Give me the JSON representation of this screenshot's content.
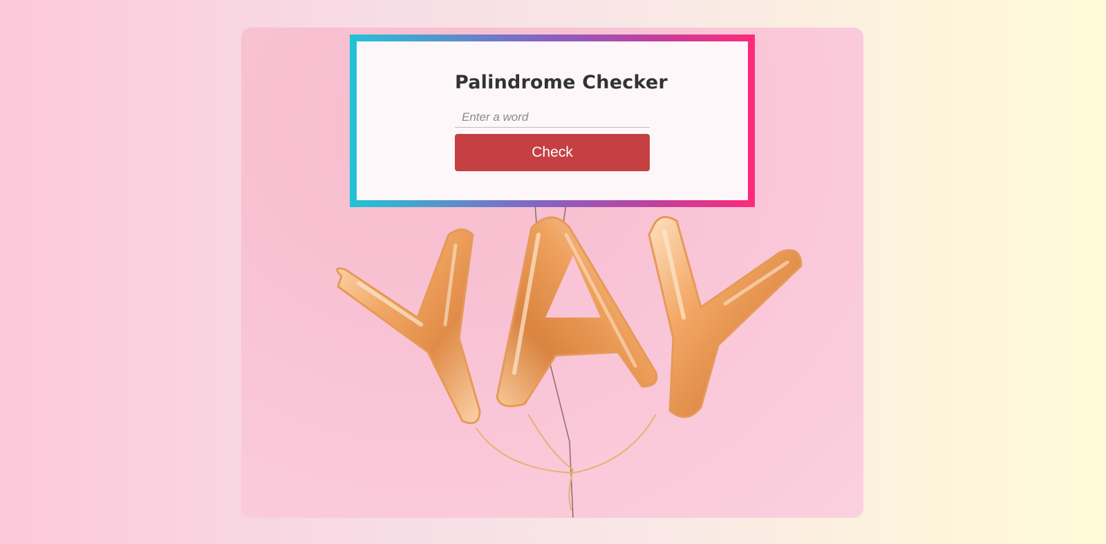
{
  "app": {
    "title": "Palindrome Checker"
  },
  "form": {
    "input_placeholder": "Enter a word",
    "input_value": "",
    "button_label": "Check"
  },
  "background_image": {
    "text": "YAY"
  },
  "colors": {
    "button": "#c44042",
    "border_gradient_start": "#20c4d6",
    "border_gradient_end": "#ff2a7a",
    "card": "#fdf7f9",
    "photo_background": "#f9c4d6",
    "balloon": "#f0a860"
  }
}
